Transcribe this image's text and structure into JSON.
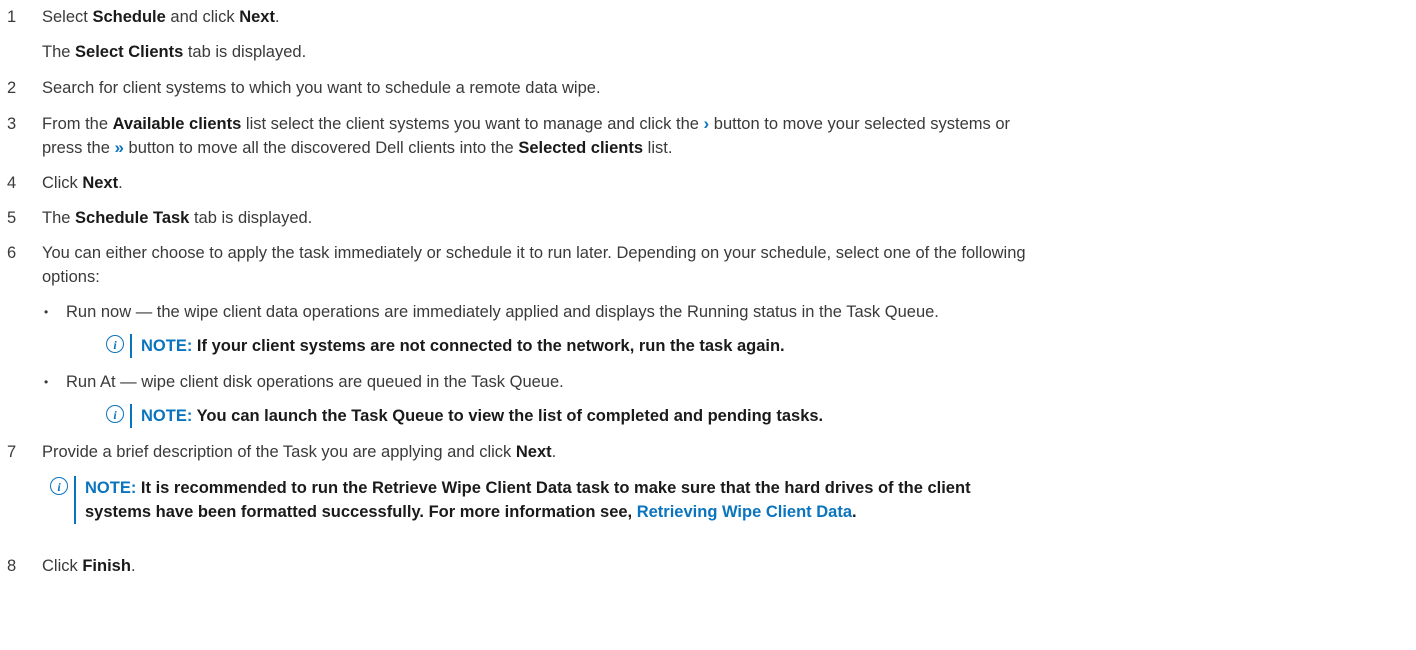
{
  "steps": [
    {
      "num": "1",
      "a": "Select ",
      "b1": "Schedule",
      "c": " and click ",
      "b2": "Next",
      "d": "."
    },
    {
      "sub_a": "The ",
      "sub_b": "Select Clients",
      "sub_c": " tab is displayed."
    },
    {
      "num": "2",
      "text": "Search for client systems to which you want to schedule a remote data wipe."
    },
    {
      "num": "3",
      "l1_a": "From the ",
      "l1_b": "Available clients",
      "l1_c": " list select the client systems you want to manage and click the ",
      "chev_single": "›",
      "l1_d": " button to move your selected systems or",
      "l2_a": "press the ",
      "chev_double": "»",
      "l2_b": " button to move all the discovered Dell clients into the ",
      "l2_c": "Selected clients",
      "l2_d": " list."
    },
    {
      "num": "4",
      "a": "Click ",
      "b": "Next",
      "c": "."
    },
    {
      "num": "5",
      "a": "The ",
      "b": "Schedule Task",
      "c": " tab is displayed."
    },
    {
      "num": "6",
      "l1": "You can either choose to apply the task immediately or schedule it to run later. Depending on your schedule, select one of the following",
      "l2": "options:"
    },
    {
      "bullet1": "Run now — the wipe client data operations are immediately applied and displays the Running status in the Task Queue."
    },
    {
      "note1_label": "NOTE:",
      "note1_text": " If your client systems are not connected to the network, run the task again."
    },
    {
      "bullet2": "Run At — wipe client disk operations are queued in the Task Queue."
    },
    {
      "note2_label": "NOTE:",
      "note2_text": " You can launch the Task Queue to view the list of completed and pending tasks."
    },
    {
      "num": "7",
      "a": "Provide a brief description of the Task you are applying and click ",
      "b": "Next",
      "c": "."
    },
    {
      "note3_label": "NOTE:",
      "note3_l1": " It is recommended to run the Retrieve Wipe Client Data task to make sure that the hard drives of the client",
      "note3_l2_a": "systems have been formatted successfully. For more information see, ",
      "note3_link": "Retrieving Wipe Client Data",
      "note3_l2_b": "."
    },
    {
      "num": "8",
      "a": "Click ",
      "b": "Finish",
      "c": "."
    }
  ],
  "icons": {
    "info": "i",
    "bullet": "•"
  }
}
